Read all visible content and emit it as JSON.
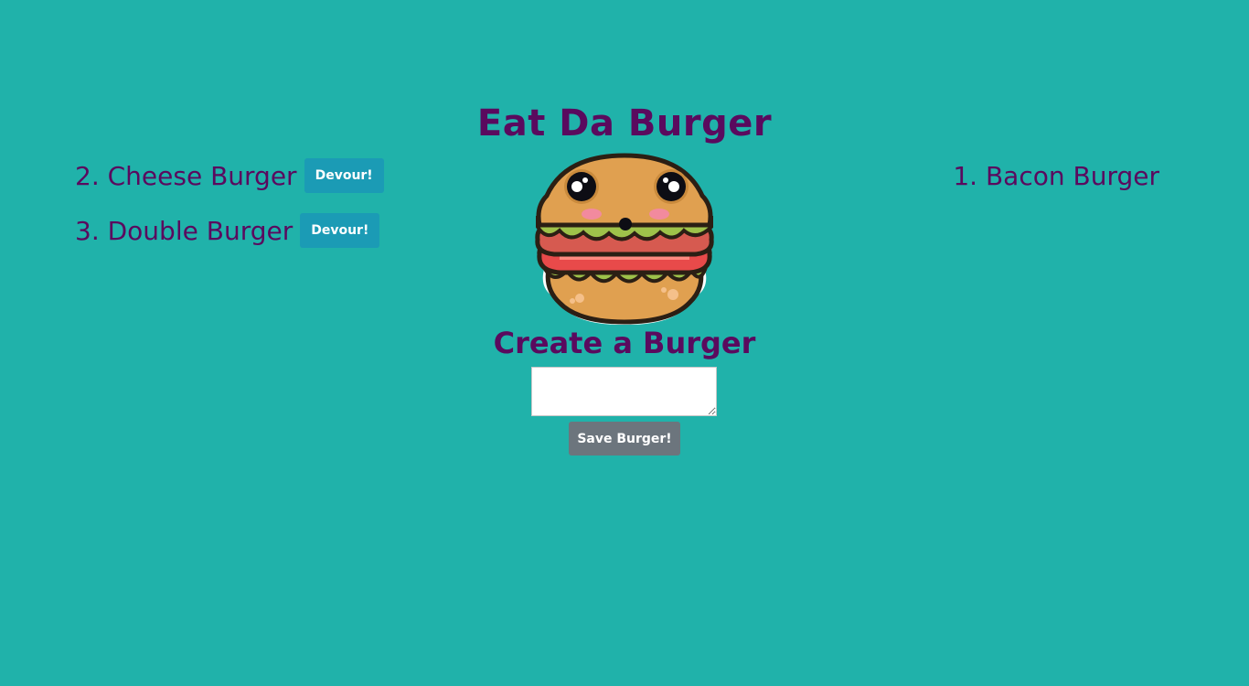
{
  "page": {
    "title": "Eat Da Burger"
  },
  "uneaten_burgers": [
    {
      "label": "2. Cheese Burger",
      "button_label": "Devour!"
    },
    {
      "label": "3. Double Burger",
      "button_label": "Devour!"
    }
  ],
  "devoured_burgers": [
    {
      "label": "1. Bacon Burger"
    }
  ],
  "mascot": {
    "icon": "burger-mascot-icon"
  },
  "create_form": {
    "heading": "Create a Burger",
    "input_value": "",
    "input_placeholder": "",
    "submit_label": "Save Burger!"
  },
  "colors": {
    "background": "#20b2aa",
    "text": "#5a0a5e",
    "devour_button": "#1b9bb5",
    "save_button": "#6c757d"
  }
}
